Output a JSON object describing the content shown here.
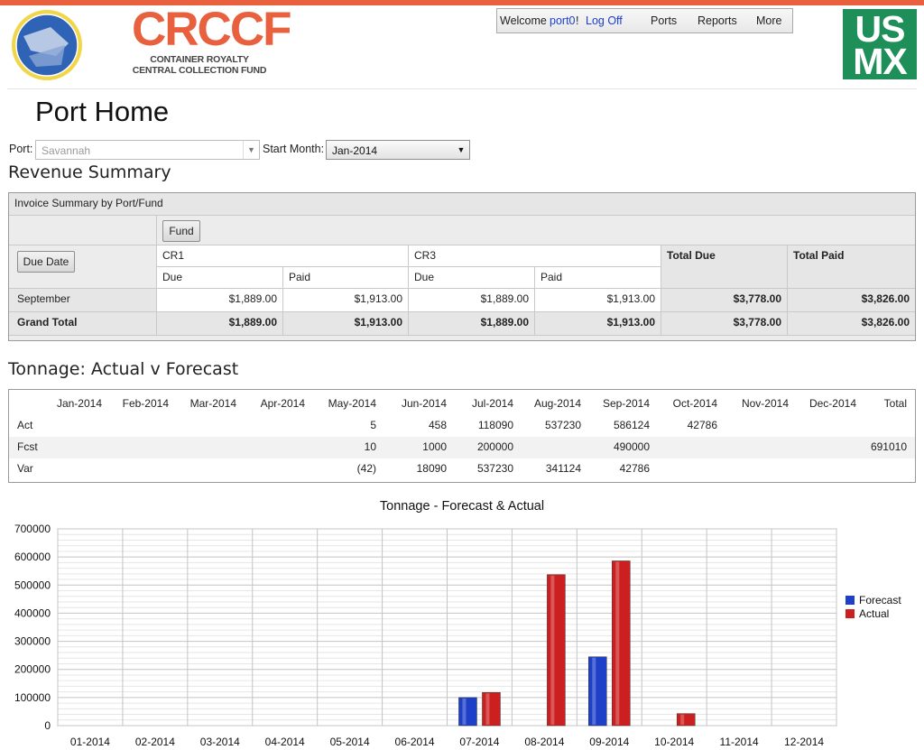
{
  "header": {
    "brand_title": "CRCCF",
    "brand_sub_1": "CONTAINER ROYALTY",
    "brand_sub_2": "CENTRAL COLLECTION FUND",
    "usmx_line1": "US",
    "usmx_line2": "MX",
    "welcome": "Welcome",
    "user": "port0",
    "bang": "!",
    "logoff": "Log Off",
    "menu": [
      "Ports",
      "Reports",
      "More"
    ]
  },
  "page": {
    "title": "Port Home",
    "port_label": "Port:",
    "port_value": "Savannah",
    "start_label": "Start Month:",
    "start_value": "Jan-2014"
  },
  "revenue": {
    "title": "Revenue Summary",
    "caption": "Invoice Summary by Port/Fund",
    "fund_button": "Fund",
    "due_date_button": "Due Date",
    "groups": [
      "CR1",
      "CR3"
    ],
    "sub": [
      "Due",
      "Paid",
      "Due",
      "Paid"
    ],
    "total_due": "Total Due",
    "total_paid": "Total Paid",
    "rows": [
      {
        "label": "September",
        "values": [
          "$1,889.00",
          "$1,913.00",
          "$1,889.00",
          "$1,913.00",
          "$3,778.00",
          "$3,826.00"
        ]
      },
      {
        "label": "Grand Total",
        "values": [
          "$1,889.00",
          "$1,913.00",
          "$1,889.00",
          "$1,913.00",
          "$3,778.00",
          "$3,826.00"
        ]
      }
    ]
  },
  "tonnage": {
    "title": "Tonnage: Actual v Forecast",
    "columns": [
      "Jan-2014",
      "Feb-2014",
      "Mar-2014",
      "Apr-2014",
      "May-2014",
      "Jun-2014",
      "Jul-2014",
      "Aug-2014",
      "Sep-2014",
      "Oct-2014",
      "Nov-2014",
      "Dec-2014",
      "Total"
    ],
    "rows": [
      {
        "label": "Act",
        "values": [
          "",
          "",
          "",
          "",
          "5",
          "458",
          "118090",
          "537230",
          "586124",
          "42786",
          "",
          "",
          ""
        ]
      },
      {
        "label": "Fcst",
        "values": [
          "",
          "",
          "",
          "",
          "10",
          "1000",
          "200000",
          "",
          "490000",
          "",
          "",
          "",
          "691010"
        ]
      },
      {
        "label": "Var",
        "values": [
          "",
          "",
          "",
          "",
          "(42)",
          "18090",
          "537230",
          "341124",
          "42786",
          "",
          "",
          "",
          ""
        ]
      }
    ]
  },
  "chart_data": {
    "type": "bar",
    "title": "Tonnage - Forecast & Actual",
    "categories": [
      "01-2014",
      "02-2014",
      "03-2014",
      "04-2014",
      "05-2014",
      "06-2014",
      "07-2014",
      "08-2014",
      "09-2014",
      "10-2014",
      "11-2014",
      "12-2014"
    ],
    "series": [
      {
        "name": "Forecast",
        "color": "#1e3fc8",
        "values": [
          0,
          0,
          0,
          0,
          0,
          0,
          100000,
          0,
          245000,
          0,
          0,
          0
        ]
      },
      {
        "name": "Actual",
        "color": "#cc1f1f",
        "values": [
          0,
          0,
          0,
          0,
          0,
          0,
          118090,
          537230,
          586124,
          42786,
          0,
          0
        ]
      }
    ],
    "ylim": [
      0,
      700000
    ],
    "yticks": [
      0,
      100000,
      200000,
      300000,
      400000,
      500000,
      600000,
      700000
    ],
    "grid": true,
    "legend": "right"
  }
}
